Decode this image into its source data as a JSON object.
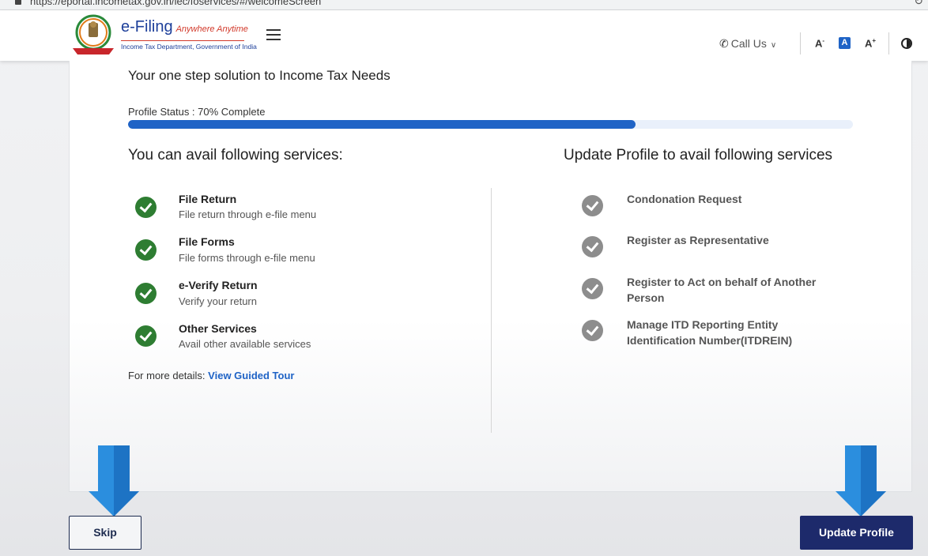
{
  "browser": {
    "url": "https://eportal.incometax.gov.in/iec/foservices/#/welcomeScreen"
  },
  "header": {
    "brand_main": "e-Filing",
    "brand_tagline": "Anywhere Anytime",
    "brand_sub": "Income Tax Department, Government of India",
    "call_us": "Call Us",
    "font_decrease": "A",
    "font_default": "A",
    "font_increase": "A"
  },
  "main": {
    "tagline": "Your one step solution to Income Tax Needs",
    "profile_status_label": "Profile Status : 70% Complete",
    "profile_progress_percent": 70,
    "left_title": "You can avail following services:",
    "right_title": "Update Profile to avail following services",
    "available_services": [
      {
        "title": "File Return",
        "desc": "File return through e-file menu"
      },
      {
        "title": "File Forms",
        "desc": "File forms through e-file menu"
      },
      {
        "title": "e-Verify Return",
        "desc": "Verify your return"
      },
      {
        "title": "Other Services",
        "desc": "Avail other available services"
      }
    ],
    "locked_services": [
      {
        "title": "Condonation Request"
      },
      {
        "title": "Register as Representative"
      },
      {
        "title": "Register to Act on behalf of Another Person"
      },
      {
        "title": "Manage ITD Reporting Entity Identification Number(ITDREIN)"
      }
    ],
    "more_details_label": "For more details:",
    "guided_tour_link": "View Guided Tour"
  },
  "actions": {
    "skip": "Skip",
    "update_profile": "Update Profile"
  },
  "colors": {
    "primary_blue": "#1f63c6",
    "navy_button": "#1d2a6b",
    "success_green": "#2e7d32",
    "locked_grey": "#8d8d8d",
    "annotation_arrow": "#2b8ede"
  }
}
